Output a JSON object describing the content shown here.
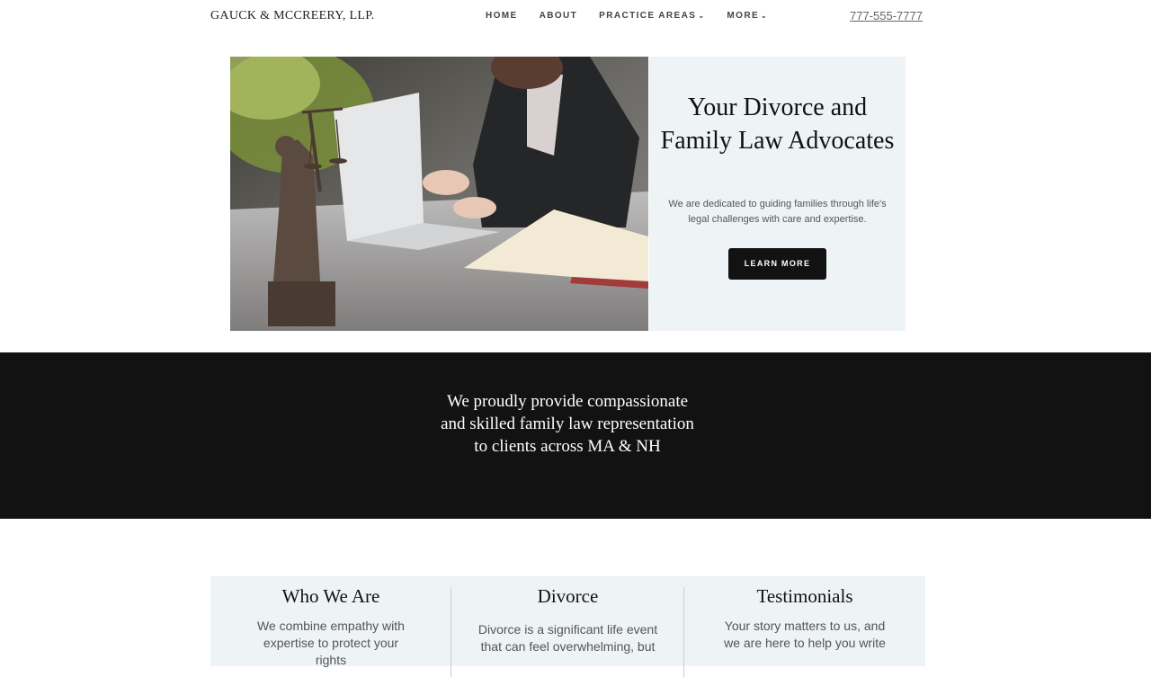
{
  "nav": {
    "logo": "GAUCK & MCCREERY, LLP.",
    "items": [
      {
        "label": "HOME",
        "has_caret": false
      },
      {
        "label": "ABOUT",
        "has_caret": false
      },
      {
        "label": "PRACTICE AREAS",
        "has_caret": true
      },
      {
        "label": "MORE",
        "has_caret": true
      }
    ],
    "phone": "777-555-7777"
  },
  "hero": {
    "title": "Your Divorce and Family Law Advocates",
    "subtitle": "We are dedicated to guiding families through life's legal challenges with care and expertise.",
    "button": "LEARN MORE"
  },
  "band": {
    "text": "We proudly provide compassionate and skilled family law representation to clients across MA & NH"
  },
  "cards": [
    {
      "title": "Who We Are",
      "text": "We combine empathy with expertise to protect your rights"
    },
    {
      "title": "Divorce",
      "text": "Divorce is a significant life event that can feel overwhelming, but"
    },
    {
      "title": "Testimonials",
      "text": "Your story matters to us, and we are here to help you write"
    }
  ],
  "colors": {
    "dark_band": "#121212",
    "panel_bg": "#eef3f6",
    "button_bg": "#121212"
  }
}
